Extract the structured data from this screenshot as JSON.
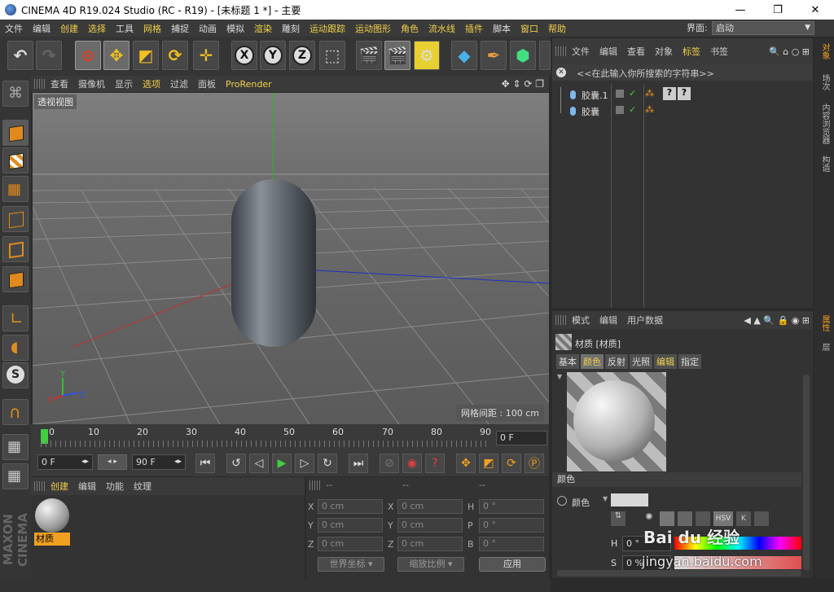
{
  "window": {
    "title": "CINEMA 4D R19.024 Studio (RC - R19) - [未标题 1 *] - 主要",
    "controls": [
      "—",
      "❐",
      "✕"
    ]
  },
  "menubar": {
    "items": [
      "文件",
      "编辑",
      "创建",
      "选择",
      "工具",
      "网格",
      "捕捉",
      "动画",
      "模拟",
      "渲染",
      "雕刻",
      "运动跟踪",
      "运动图形",
      "角色",
      "流水线",
      "插件",
      "脚本",
      "窗口",
      "帮助"
    ],
    "interface_label": "界面:",
    "interface_value": "启动"
  },
  "viewport": {
    "menu": [
      "查看",
      "摄像机",
      "显示",
      "选项",
      "过滤",
      "面板",
      "ProRender"
    ],
    "view_name": "透视视图",
    "grid_spacing": "网格间距 : 100 cm"
  },
  "timeline": {
    "ticks": [
      "0",
      "10",
      "20",
      "30",
      "40",
      "50",
      "60",
      "70",
      "80",
      "90"
    ],
    "current_frame": "0 F",
    "start_frame": "0 F",
    "end_frame": "90 F"
  },
  "material_manager": {
    "menu": [
      "创建",
      "编辑",
      "功能",
      "纹理"
    ],
    "material_name": "材质"
  },
  "coordinates": {
    "headers": [
      "--",
      "--",
      "--"
    ],
    "rows": [
      {
        "a": "X",
        "av": "0 cm",
        "b": "X",
        "bv": "0 cm",
        "c": "H",
        "cv": "0 °"
      },
      {
        "a": "Y",
        "av": "0 cm",
        "b": "Y",
        "bv": "0 cm",
        "c": "P",
        "cv": "0 °"
      },
      {
        "a": "Z",
        "av": "0 cm",
        "b": "Z",
        "bv": "0 cm",
        "c": "B",
        "cv": "0 °"
      }
    ],
    "world_coord": "世界坐标",
    "scale_ratio": "缩放比例",
    "apply": "应用"
  },
  "object_manager": {
    "menu": [
      "文件",
      "编辑",
      "查看",
      "对象",
      "标签",
      "书签"
    ],
    "search_placeholder": "<<在此输入你所搜索的字符串>>",
    "objects": [
      "胶囊.1",
      "胶囊"
    ]
  },
  "attributes": {
    "menu": [
      "模式",
      "编辑",
      "用户数据"
    ],
    "title": "材质 [材质]",
    "tabs": [
      "基本",
      "颜色",
      "反射",
      "光照",
      "编辑",
      "指定"
    ],
    "section": "颜色",
    "color_label": "颜色",
    "h_label": "H",
    "h_value": "0 °",
    "s_label": "S",
    "s_value": "0 %"
  },
  "right_tabs": [
    "对象",
    "场次",
    "内容浏览器",
    "构造",
    "属性",
    "层"
  ],
  "left_brand": "MAXON CINEMA 4D",
  "watermark": {
    "logo": "Bai du 经验",
    "url": "jingyan.baidu.com"
  },
  "colors": {
    "accent": "#f0a020",
    "highlight_text": "#f0d04a",
    "bg": "#2b2b2b"
  }
}
